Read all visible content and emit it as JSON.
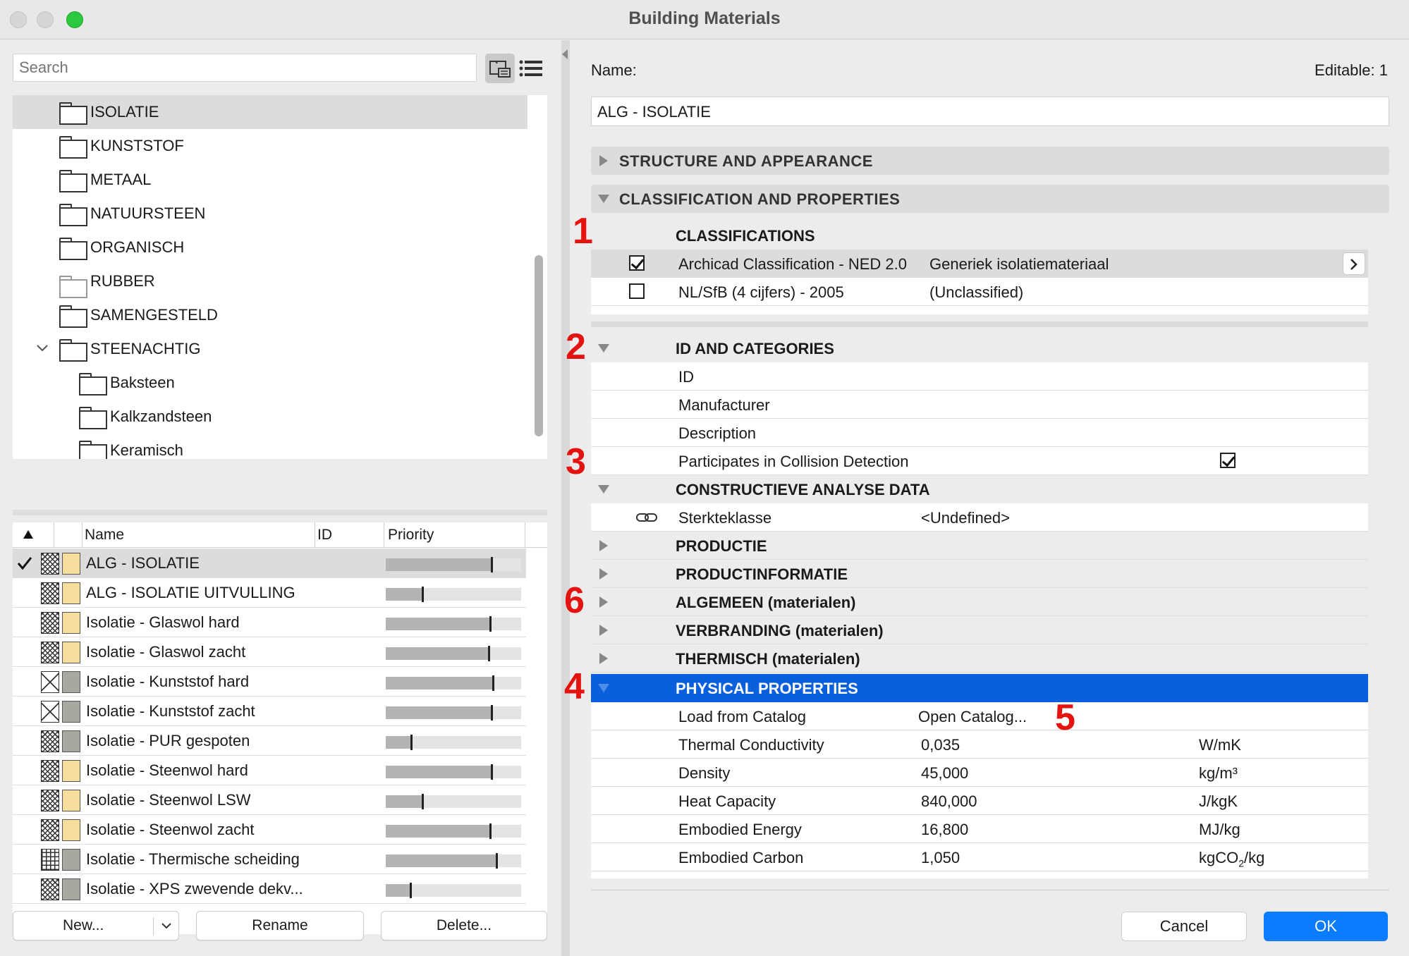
{
  "window": {
    "title": "Building Materials"
  },
  "search": {
    "placeholder": "Search"
  },
  "tree": [
    {
      "label": "ISOLATIE",
      "selected": true,
      "indent": 0
    },
    {
      "label": "KUNSTSTOF",
      "indent": 0
    },
    {
      "label": "METAAL",
      "indent": 0
    },
    {
      "label": "NATUURSTEEN",
      "indent": 0
    },
    {
      "label": "ORGANISCH",
      "indent": 0
    },
    {
      "label": "RUBBER",
      "indent": 0,
      "dim": true
    },
    {
      "label": "SAMENGESTELD",
      "indent": 0
    },
    {
      "label": "STEENACHTIG",
      "indent": 0,
      "expanded": true
    },
    {
      "label": "Baksteen",
      "indent": 1
    },
    {
      "label": "Kalkzandsteen",
      "indent": 1
    },
    {
      "label": "Keramisch",
      "indent": 1
    }
  ],
  "list": {
    "headers": {
      "name": "Name",
      "id": "ID",
      "priority": "Priority"
    },
    "rows": [
      {
        "name": "ALG - ISOLATIE",
        "priority": 0.78,
        "fill": "hatch",
        "color": "#f5dd9c",
        "selected": true
      },
      {
        "name": "ALG - ISOLATIE UITVULLING",
        "priority": 0.27,
        "fill": "hatch",
        "color": "#f5dd9c"
      },
      {
        "name": "Isolatie - Glaswol hard",
        "priority": 0.77,
        "fill": "hatch",
        "color": "#f5dd9c"
      },
      {
        "name": "Isolatie - Glaswol zacht",
        "priority": 0.76,
        "fill": "hatch",
        "color": "#f5dd9c"
      },
      {
        "name": "Isolatie - Kunststof hard",
        "priority": 0.79,
        "fill": "hatch2",
        "color": "#a8a8a0"
      },
      {
        "name": "Isolatie - Kunststof zacht",
        "priority": 0.78,
        "fill": "hatch2",
        "color": "#a8a8a0"
      },
      {
        "name": "Isolatie - PUR gespoten",
        "priority": 0.19,
        "fill": "hatch",
        "color": "#a8a8a0"
      },
      {
        "name": "Isolatie - Steenwol hard",
        "priority": 0.78,
        "fill": "hatch",
        "color": "#f5dd9c"
      },
      {
        "name": "Isolatie - Steenwol LSW",
        "priority": 0.27,
        "fill": "hatch",
        "color": "#f5dd9c"
      },
      {
        "name": "Isolatie - Steenwol zacht",
        "priority": 0.77,
        "fill": "hatch",
        "color": "#f5dd9c"
      },
      {
        "name": "Isolatie - Thermische scheiding",
        "priority": 0.82,
        "fill": "grid",
        "color": "#a8a8a0"
      },
      {
        "name": "Isolatie - XPS zwevende dekv...",
        "priority": 0.18,
        "fill": "hatch",
        "color": "#a8a8a0"
      }
    ]
  },
  "left_buttons": {
    "new": "New...",
    "rename": "Rename",
    "delete": "Delete..."
  },
  "details": {
    "name_label": "Name:",
    "editable_label": "Editable: 1",
    "name_value": "ALG - ISOLATIE",
    "sections": {
      "structure": "STRUCTURE AND APPEARANCE",
      "classification": "CLASSIFICATION AND PROPERTIES"
    },
    "classifications": {
      "title": "CLASSIFICATIONS",
      "rows": [
        {
          "system": "Archicad Classification - NED 2.0",
          "value": "Generiek isolatiemateriaal",
          "checked": true
        },
        {
          "system": "NL/SfB (4 cijfers) - 2005",
          "value": "(Unclassified)",
          "checked": false
        }
      ]
    },
    "id_categories": {
      "title": "ID AND CATEGORIES",
      "rows": [
        "ID",
        "Manufacturer",
        "Description",
        "Participates in Collision Detection"
      ]
    },
    "constructive": {
      "title": "CONSTRUCTIEVE ANALYSE DATA",
      "row_label": "Sterkteklasse",
      "row_value": "<Undefined>"
    },
    "groups": [
      "PRODUCTIE",
      "PRODUCTINFORMATIE",
      "ALGEMEEN (materialen)",
      "VERBRANDING (materialen)",
      "THERMISCH (materialen)"
    ],
    "physical": {
      "title": "PHYSICAL PROPERTIES",
      "load_label": "Load from Catalog",
      "load_value": "Open Catalog...",
      "rows": [
        {
          "label": "Thermal Conductivity",
          "value": "0,035",
          "unit": "W/mK"
        },
        {
          "label": "Density",
          "value": "45,000",
          "unit": "kg/m³"
        },
        {
          "label": "Heat Capacity",
          "value": "840,000",
          "unit": "J/kgK"
        },
        {
          "label": "Embodied Energy",
          "value": "16,800",
          "unit": "MJ/kg"
        },
        {
          "label": "Embodied Carbon",
          "value": "1,050",
          "unit_main": "kgCO",
          "unit_sub": "2",
          "unit_tail": "/kg"
        }
      ]
    }
  },
  "annotations": [
    "1",
    "2",
    "3",
    "4",
    "5",
    "6"
  ],
  "buttons": {
    "cancel": "Cancel",
    "ok": "OK"
  },
  "colors": {
    "accent": "#0a5fdc",
    "annotation": "#e4130f",
    "selection": "#dcdcdc"
  }
}
